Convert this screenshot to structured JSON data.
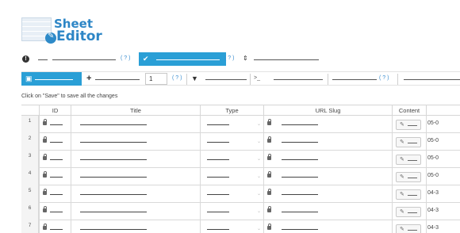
{
  "logo": {
    "word1": "Sheet",
    "word2": "Editor"
  },
  "toolbar_top": {
    "help1": "( ? )",
    "help2": "( ? )"
  },
  "toolbar": {
    "rows_value": "1",
    "help1": "( ? )",
    "help2": "( ? )"
  },
  "hint": "Click on \"Save\" to save all the changes",
  "table": {
    "columns": [
      "ID",
      "Title",
      "Type",
      "URL Slug",
      "Content"
    ],
    "rows": [
      {
        "n": "1",
        "date": "05-0"
      },
      {
        "n": "2",
        "date": "05-0"
      },
      {
        "n": "3",
        "date": "05-0"
      },
      {
        "n": "4",
        "date": "05-0"
      },
      {
        "n": "5",
        "date": "04-3"
      },
      {
        "n": "6",
        "date": "04-3"
      },
      {
        "n": "7",
        "date": "04-3"
      }
    ]
  },
  "icons": {
    "info": "info-icon",
    "check": "check-icon",
    "sort": "sort-icon",
    "save": "floppy-icon",
    "add": "plus-icon",
    "filter": "filter-icon",
    "terminal": "terminal-icon",
    "lock": "lock-icon",
    "edit": "pencil-icon"
  },
  "colors": {
    "accent": "#2a9fd6",
    "logo": "#2d86c6",
    "help_link": "#3b8ed0"
  }
}
